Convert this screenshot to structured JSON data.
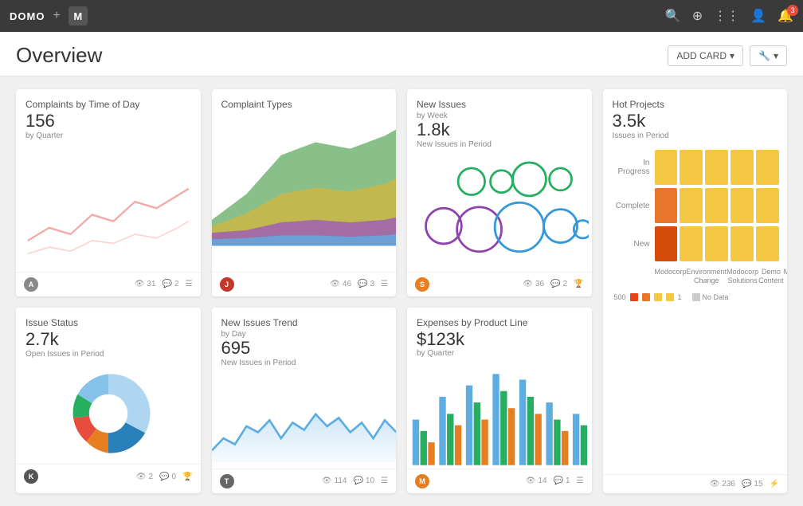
{
  "topnav": {
    "logo": "DOMO",
    "plus": "+",
    "m_label": "M",
    "bell_count": "3"
  },
  "header": {
    "title": "Overview",
    "add_card_label": "ADD CARD",
    "wrench_label": "🔧"
  },
  "cards": {
    "complaints_time": {
      "title": "Complaints by Time of Day",
      "value": "156",
      "subtitle": "by Quarter",
      "views": "31",
      "comments": "2"
    },
    "complaint_types": {
      "title": "Complaint Types",
      "value": "",
      "subtitle": "",
      "views": "46",
      "comments": "3"
    },
    "new_issues": {
      "title": "New Issues",
      "label": "by Week",
      "value": "1.8k",
      "subtitle": "New Issues in Period",
      "views": "36",
      "comments": "2"
    },
    "hot_projects": {
      "title": "Hot Projects",
      "value": "3.5k",
      "subtitle": "Issues in Period",
      "views": "236",
      "comments": "15",
      "rows": [
        "In Progress",
        "Complete",
        "New"
      ],
      "cols": [
        "Modocorp",
        "Environment Change",
        "Modocorp Solutions",
        "Demo Content",
        "ModoX"
      ],
      "legend_num": "500",
      "legend_no_data": "No Data"
    },
    "issue_status": {
      "title": "Issue Status",
      "value": "2.7k",
      "subtitle": "Open Issues in Period",
      "views": "2",
      "comments": "0"
    },
    "new_issues_trend": {
      "title": "New Issues Trend",
      "label": "by Day",
      "value": "695",
      "subtitle": "New Issues in Period",
      "views": "114",
      "comments": "10"
    },
    "expenses": {
      "title": "Expenses by Product Line",
      "label": "by Quarter",
      "value": "$123k",
      "subtitle": "",
      "views": "14",
      "comments": "1"
    }
  }
}
